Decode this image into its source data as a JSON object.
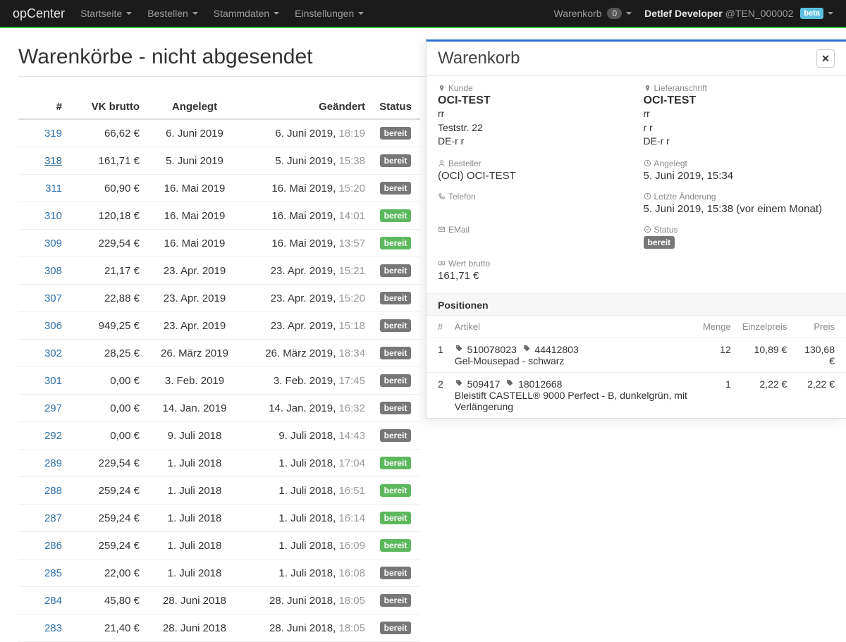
{
  "navbar": {
    "brand": "opCenter",
    "items": [
      "Startseite",
      "Bestellen",
      "Stammdaten",
      "Einstellungen"
    ],
    "cart_label": "Warenkorb",
    "cart_count": "0",
    "user_name": "Detlef Developer",
    "user_tenant": "@TEN_000002",
    "beta": "beta"
  },
  "page": {
    "title": "Warenkörbe - nicht abgesendet",
    "cols": {
      "num": "#",
      "vk": "VK brutto",
      "angelegt": "Angelegt",
      "geaendert": "Geändert",
      "status": "Status"
    },
    "status_label": "bereit",
    "rows": [
      {
        "id": "319",
        "vk": "66,62 €",
        "angelegt": "6. Juni 2019",
        "g_date": "6. Juni 2019",
        "g_time": "18:19",
        "green": false,
        "active": false
      },
      {
        "id": "318",
        "vk": "161,71 €",
        "angelegt": "5. Juni 2019",
        "g_date": "5. Juni 2019",
        "g_time": "15:38",
        "green": false,
        "active": true
      },
      {
        "id": "311",
        "vk": "60,90 €",
        "angelegt": "16. Mai 2019",
        "g_date": "16. Mai 2019",
        "g_time": "15:20",
        "green": false,
        "active": false
      },
      {
        "id": "310",
        "vk": "120,18 €",
        "angelegt": "16. Mai 2019",
        "g_date": "16. Mai 2019",
        "g_time": "14:01",
        "green": true,
        "active": false
      },
      {
        "id": "309",
        "vk": "229,54 €",
        "angelegt": "16. Mai 2019",
        "g_date": "16. Mai 2019",
        "g_time": "13:57",
        "green": true,
        "active": false
      },
      {
        "id": "308",
        "vk": "21,17 €",
        "angelegt": "23. Apr. 2019",
        "g_date": "23. Apr. 2019",
        "g_time": "15:21",
        "green": false,
        "active": false
      },
      {
        "id": "307",
        "vk": "22,88 €",
        "angelegt": "23. Apr. 2019",
        "g_date": "23. Apr. 2019",
        "g_time": "15:20",
        "green": false,
        "active": false
      },
      {
        "id": "306",
        "vk": "949,25 €",
        "angelegt": "23. Apr. 2019",
        "g_date": "23. Apr. 2019",
        "g_time": "15:18",
        "green": false,
        "active": false
      },
      {
        "id": "302",
        "vk": "28,25 €",
        "angelegt": "26. März 2019",
        "g_date": "26. März 2019",
        "g_time": "18:34",
        "green": false,
        "active": false
      },
      {
        "id": "301",
        "vk": "0,00 €",
        "angelegt": "3. Feb. 2019",
        "g_date": "3. Feb. 2019",
        "g_time": "17:45",
        "green": false,
        "active": false
      },
      {
        "id": "297",
        "vk": "0,00 €",
        "angelegt": "14. Jan. 2019",
        "g_date": "14. Jan. 2019",
        "g_time": "16:32",
        "green": false,
        "active": false
      },
      {
        "id": "292",
        "vk": "0,00 €",
        "angelegt": "9. Juli 2018",
        "g_date": "9. Juli 2018",
        "g_time": "14:43",
        "green": false,
        "active": false
      },
      {
        "id": "289",
        "vk": "229,54 €",
        "angelegt": "1. Juli 2018",
        "g_date": "1. Juli 2018",
        "g_time": "17:04",
        "green": true,
        "active": false
      },
      {
        "id": "288",
        "vk": "259,24 €",
        "angelegt": "1. Juli 2018",
        "g_date": "1. Juli 2018",
        "g_time": "16:51",
        "green": true,
        "active": false
      },
      {
        "id": "287",
        "vk": "259,24 €",
        "angelegt": "1. Juli 2018",
        "g_date": "1. Juli 2018",
        "g_time": "16:14",
        "green": true,
        "active": false
      },
      {
        "id": "286",
        "vk": "259,24 €",
        "angelegt": "1. Juli 2018",
        "g_date": "1. Juli 2018",
        "g_time": "16:09",
        "green": true,
        "active": false
      },
      {
        "id": "285",
        "vk": "22,00 €",
        "angelegt": "1. Juli 2018",
        "g_date": "1. Juli 2018",
        "g_time": "16:08",
        "green": false,
        "active": false
      },
      {
        "id": "284",
        "vk": "45,80 €",
        "angelegt": "28. Juni 2018",
        "g_date": "28. Juni 2018",
        "g_time": "18:05",
        "green": false,
        "active": false
      },
      {
        "id": "283",
        "vk": "21,40 €",
        "angelegt": "28. Juni 2018",
        "g_date": "28. Juni 2018",
        "g_time": "18:05",
        "green": false,
        "active": false
      }
    ]
  },
  "panel": {
    "title": "Warenkorb",
    "labels": {
      "kunde": "Kunde",
      "liefer": "Lieferanschrift",
      "besteller": "Besteller",
      "angelegt": "Angelegt",
      "telefon": "Telefon",
      "letzte": "Letzte Änderung",
      "email": "EMail",
      "status": "Status",
      "wert": "Wert brutto",
      "positionen": "Positionen",
      "col_num": "#",
      "col_art": "Artikel",
      "col_menge": "Menge",
      "col_ep": "Einzelpreis",
      "col_preis": "Preis"
    },
    "kunde": {
      "name": "OCI-TEST",
      "l1": "rr",
      "l2": "Teststr. 22",
      "l3": "DE-r r"
    },
    "liefer": {
      "name": "OCI-TEST",
      "l1": "rr",
      "l2": "r r",
      "l3": "DE-r r"
    },
    "besteller": "(OCI) OCI-TEST",
    "angelegt": "5. Juni 2019, 15:34",
    "letzte": "5. Juni 2019, 15:38 (vor einem Monat)",
    "status": "bereit",
    "wert": "161,71 €",
    "positions": [
      {
        "n": "1",
        "sku1": "510078023",
        "sku2": "44412803",
        "name": "Gel-Mousepad - schwarz",
        "menge": "12",
        "ep": "10,89 €",
        "preis": "130,68 €"
      },
      {
        "n": "2",
        "sku1": "509417",
        "sku2": "18012668",
        "name": "Bleistift CASTELL® 9000 Perfect - B, dunkelgrün, mit Verlängerung",
        "menge": "1",
        "ep": "2,22 €",
        "preis": "2,22 €"
      }
    ]
  }
}
